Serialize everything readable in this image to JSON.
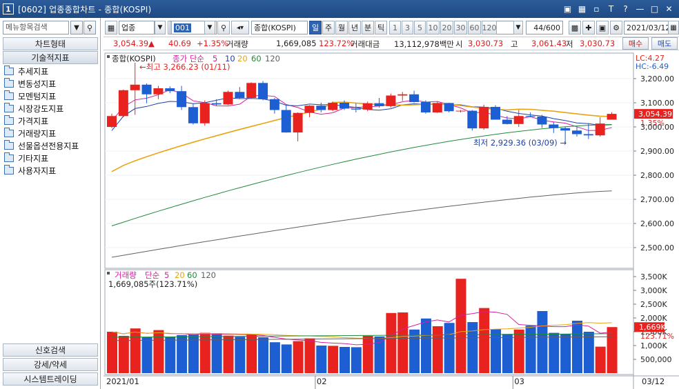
{
  "window": {
    "number": "1",
    "title": "[0602] 업종종합차트 - 종합(KOSPI)"
  },
  "left_panel": {
    "search_placeholder": "메뉴항목검색",
    "tab_chart_type": "차트형태",
    "tab_technical": "기술적지표",
    "tree_items": [
      "추세지표",
      "변동성지표",
      "모멘텀지표",
      "시장강도지표",
      "가격지표",
      "거래량지표",
      "선물옵션전용지표",
      "기타지표",
      "사용자지표"
    ],
    "bottom_tabs": [
      "신호검색",
      "강세/약세",
      "시스템트레이딩"
    ]
  },
  "toolbar": {
    "sector_type": "업종",
    "prev_label": "전",
    "code": "001",
    "index_name": "종합(KOSPI)",
    "periods": [
      "일",
      "주",
      "월",
      "년",
      "분",
      "틱"
    ],
    "active_period": "일",
    "intervals": [
      "1",
      "3",
      "5",
      "10",
      "20",
      "30",
      "60",
      "120"
    ],
    "count": "44",
    "count_total": "/600",
    "date": "2021/03/12"
  },
  "infobar": {
    "price": "3,054.39",
    "change": "40.69",
    "change_pct": "+1.35%",
    "volume_label": "거래량",
    "volume": "1,669,085",
    "volume_ratio": "123.72%",
    "amount_label": "거래대금",
    "amount": "13,112,978백만",
    "open_label": "시",
    "open": "3,030.73",
    "high_label": "고",
    "high": "3,061.43",
    "low_label": "저",
    "low": "3,030.73",
    "buy_label": "매수",
    "sell_label": "매도"
  },
  "price_panel": {
    "legend_name": "종합(KOSPI)",
    "legend_ma": "종가 단순",
    "ma_periods": [
      "5",
      "10",
      "20",
      "60",
      "120"
    ],
    "ma_colors": [
      "#d4209c",
      "#1f3ea8",
      "#e8a412",
      "#1f8a3a",
      "#606060"
    ],
    "high_annotation": "최고 3,266.23 (01/11)",
    "low_annotation": "최저 2,929.36 (03/09)",
    "lc": "LC:4.27",
    "hc": "HC:-6.49",
    "current_price": "3,054.39",
    "current_pct": "1.35%",
    "y_ticks": [
      "3,200.00",
      "3,100.00",
      "3,000.00",
      "2,900.00",
      "2,800.00",
      "2,700.00",
      "2,600.00",
      "2,500.00"
    ]
  },
  "volume_panel": {
    "legend_name": "거래량",
    "legend_ma": "단순",
    "ma_periods": [
      "5",
      "20",
      "60",
      "120"
    ],
    "current_text": "1,669,085주(123.71%)",
    "current_value": "1,669K",
    "current_pct": "123.71%",
    "y_ticks": [
      "3,500K",
      "3,000K",
      "2,500K",
      "2,000K",
      "1,500K",
      "1,000K",
      "500,000"
    ]
  },
  "x_axis": {
    "labels": [
      "2021/01",
      "02",
      "03"
    ],
    "cursor_date": "03/12"
  },
  "chart_data": {
    "type": "candlestick",
    "ohlc": [
      [
        3000,
        3055,
        2995,
        3045
      ],
      [
        3045,
        3155,
        3040,
        3152
      ],
      [
        3152,
        3266,
        3050,
        3175
      ],
      [
        3175,
        3180,
        3098,
        3135
      ],
      [
        3135,
        3170,
        3115,
        3160
      ],
      [
        3160,
        3168,
        3140,
        3148
      ],
      [
        3148,
        3170,
        3070,
        3082
      ],
      [
        3082,
        3095,
        3010,
        3015
      ],
      [
        3015,
        3110,
        3005,
        3098
      ],
      [
        3098,
        3115,
        3088,
        3093
      ],
      [
        3093,
        3150,
        3090,
        3145
      ],
      [
        3145,
        3165,
        3115,
        3120
      ],
      [
        3120,
        3185,
        3118,
        3182
      ],
      [
        3182,
        3190,
        3110,
        3115
      ],
      [
        3115,
        3120,
        3055,
        3070
      ],
      [
        3070,
        3090,
        2976,
        2977
      ],
      [
        2977,
        3060,
        2940,
        3058
      ],
      [
        3058,
        3090,
        3040,
        3088
      ],
      [
        3088,
        3100,
        3060,
        3070
      ],
      [
        3070,
        3105,
        3065,
        3100
      ],
      [
        3100,
        3110,
        3070,
        3076
      ],
      [
        3076,
        3098,
        3060,
        3072
      ],
      [
        3072,
        3105,
        3065,
        3098
      ],
      [
        3098,
        3120,
        3080,
        3086
      ],
      [
        3086,
        3138,
        3080,
        3130
      ],
      [
        3130,
        3145,
        3108,
        3135
      ],
      [
        3135,
        3150,
        3101,
        3103
      ],
      [
        3103,
        3110,
        3055,
        3060
      ],
      [
        3060,
        3105,
        3058,
        3099
      ],
      [
        3099,
        3100,
        3060,
        3065
      ],
      [
        3065,
        3070,
        3060,
        3067
      ],
      [
        3067,
        3070,
        2985,
        2994
      ],
      [
        2994,
        3092,
        2988,
        3083
      ],
      [
        3083,
        3090,
        3030,
        3030
      ],
      [
        3030,
        3045,
        3010,
        3012
      ],
      [
        3012,
        3070,
        3000,
        3045
      ],
      [
        3045,
        3060,
        3040,
        3043
      ],
      [
        3043,
        3050,
        2996,
        3010
      ],
      [
        3010,
        3020,
        2975,
        2995
      ],
      [
        2995,
        3000,
        2935,
        2985
      ],
      [
        2985,
        3000,
        2960,
        2970
      ],
      [
        2970,
        3015,
        2950,
        2965
      ],
      [
        2965,
        3040,
        2960,
        3014
      ],
      [
        3030,
        3061,
        3030,
        3054
      ]
    ],
    "volume_k": [
      1500,
      1350,
      1620,
      1300,
      1560,
      1320,
      1380,
      1410,
      1460,
      1450,
      1360,
      1320,
      1390,
      1300,
      1120,
      1040,
      1160,
      1260,
      1000,
      990,
      950,
      940,
      1350,
      1330,
      2180,
      2200,
      1580,
      1980,
      1700,
      1820,
      3420,
      1850,
      2360,
      1600,
      1420,
      1580,
      1720,
      2250,
      1460,
      1420,
      1900,
      1500,
      960,
      1669
    ],
    "x_labels": [
      "2021/01",
      "02",
      "03",
      "03/12"
    ],
    "ylim": [
      2420,
      3300
    ],
    "volume_ylim": [
      0,
      3700
    ]
  }
}
